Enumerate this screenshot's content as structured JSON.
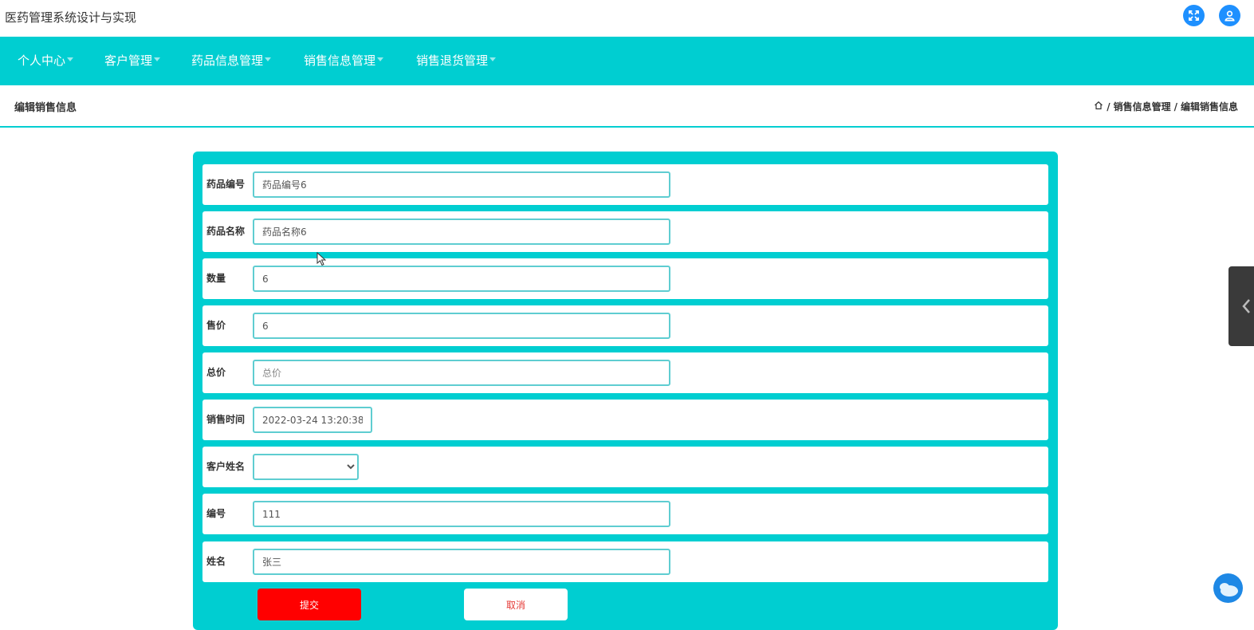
{
  "app": {
    "title": "医药管理系统设计与实现"
  },
  "nav": {
    "items": [
      {
        "label": "个人中心"
      },
      {
        "label": "客户管理"
      },
      {
        "label": "药品信息管理"
      },
      {
        "label": "销售信息管理"
      },
      {
        "label": "销售退货管理"
      }
    ]
  },
  "page": {
    "title": "编辑销售信息"
  },
  "breadcrumb": {
    "section": "销售信息管理",
    "current": "编辑销售信息",
    "sep": "/"
  },
  "form": {
    "fields": [
      {
        "label": "药品编号",
        "value": "药品编号6",
        "placeholder": "药品编号"
      },
      {
        "label": "药品名称",
        "value": "药品名称6",
        "placeholder": "药品名称"
      },
      {
        "label": "数量",
        "value": "6",
        "placeholder": "数量"
      },
      {
        "label": "售价",
        "value": "6",
        "placeholder": "售价"
      },
      {
        "label": "总价",
        "value": "",
        "placeholder": "总价"
      },
      {
        "label": "销售时间",
        "value": "2022-03-24 13:20:38",
        "placeholder": ""
      },
      {
        "label": "客户姓名",
        "value": ""
      },
      {
        "label": "编号",
        "value": "111",
        "placeholder": "编号"
      },
      {
        "label": "姓名",
        "value": "张三",
        "placeholder": "姓名"
      }
    ],
    "submit_label": "提交",
    "cancel_label": "取消"
  },
  "colors": {
    "accent": "#00ced1",
    "icon_blue": "#1e90ff",
    "submit": "#ff0000",
    "cancel_text": "#e53935"
  },
  "icons": {
    "fullscreen": "fullscreen-icon",
    "user": "user-icon",
    "home": "home-icon",
    "side_tab": "chevron-left-icon",
    "bubble": "chat-bubble-icon"
  }
}
